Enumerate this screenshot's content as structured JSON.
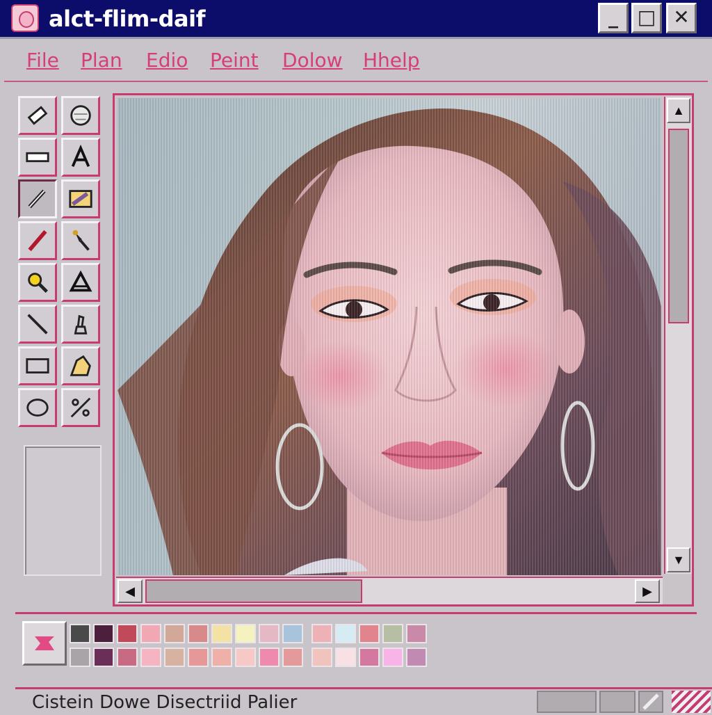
{
  "window": {
    "title": "alct-flim-daif",
    "controls": {
      "minimize": "_",
      "maximize": "□",
      "close": "✕"
    }
  },
  "menu": {
    "items": [
      "File",
      "Plan",
      "Edio",
      "Peint",
      "Dolow",
      "Hhelp"
    ]
  },
  "toolbox": {
    "tools": [
      {
        "name": "eraser-tool",
        "icon": "eraser-icon"
      },
      {
        "name": "select-free-tool",
        "icon": "lasso-circle-icon"
      },
      {
        "name": "rect-select-tool",
        "icon": "rectangle-select-icon"
      },
      {
        "name": "text-tool",
        "icon": "text-a-icon"
      },
      {
        "name": "pencil-tool",
        "icon": "pencil-icon",
        "active": true
      },
      {
        "name": "fill-tool",
        "icon": "fill-gradient-icon"
      },
      {
        "name": "brush-tool",
        "icon": "brush-icon"
      },
      {
        "name": "airbrush-tool",
        "icon": "airbrush-icon"
      },
      {
        "name": "magnifier-tool",
        "icon": "magnifier-icon"
      },
      {
        "name": "triangle-tool",
        "icon": "triangle-icon"
      },
      {
        "name": "line-tool",
        "icon": "line-icon"
      },
      {
        "name": "stamp-tool",
        "icon": "stamp-icon"
      },
      {
        "name": "rectangle-tool",
        "icon": "rectangle-icon"
      },
      {
        "name": "polygon-tool",
        "icon": "polygon-icon"
      },
      {
        "name": "ellipse-tool",
        "icon": "ellipse-icon"
      },
      {
        "name": "curve-tool",
        "icon": "curve-icon"
      }
    ]
  },
  "canvas": {
    "content": "portrait-photo",
    "scroll_arrows": {
      "up": "▲",
      "down": "▼",
      "left": "◀",
      "right": "▶"
    }
  },
  "palette": {
    "current_icon": "palette-icon",
    "group1": [
      "#4a4a4a",
      "#4c1f3c",
      "#c04a5a",
      "#f2a8b4",
      "#d2a898",
      "#d88a8a",
      "#f4e2a4",
      "#f6f2c0",
      "#e4b8c4",
      "#a8c4dc",
      "#a8a4a8",
      "#6a2e58",
      "#c86a84",
      "#f4b4c2",
      "#d8b2a0",
      "#e69898",
      "#f0b0aa",
      "#f6c8c6",
      "#ee8aae",
      "#e49a9a"
    ],
    "group2": [
      "#eeb2b6",
      "#d6ecf4",
      "#e2848e",
      "#b6bea4",
      "#c88aa8",
      "#f0c4bc",
      "#f8e0e4",
      "#d478a0",
      "#f8b4e6",
      "#c08ab2"
    ]
  },
  "status": {
    "text": "Cistein Dowe Disectriid Palier"
  },
  "colors": {
    "title_bg": "#0c0c6a",
    "accent": "#c63c70",
    "menu_text": "#d63d7a",
    "chrome": "#c9c4c9"
  }
}
